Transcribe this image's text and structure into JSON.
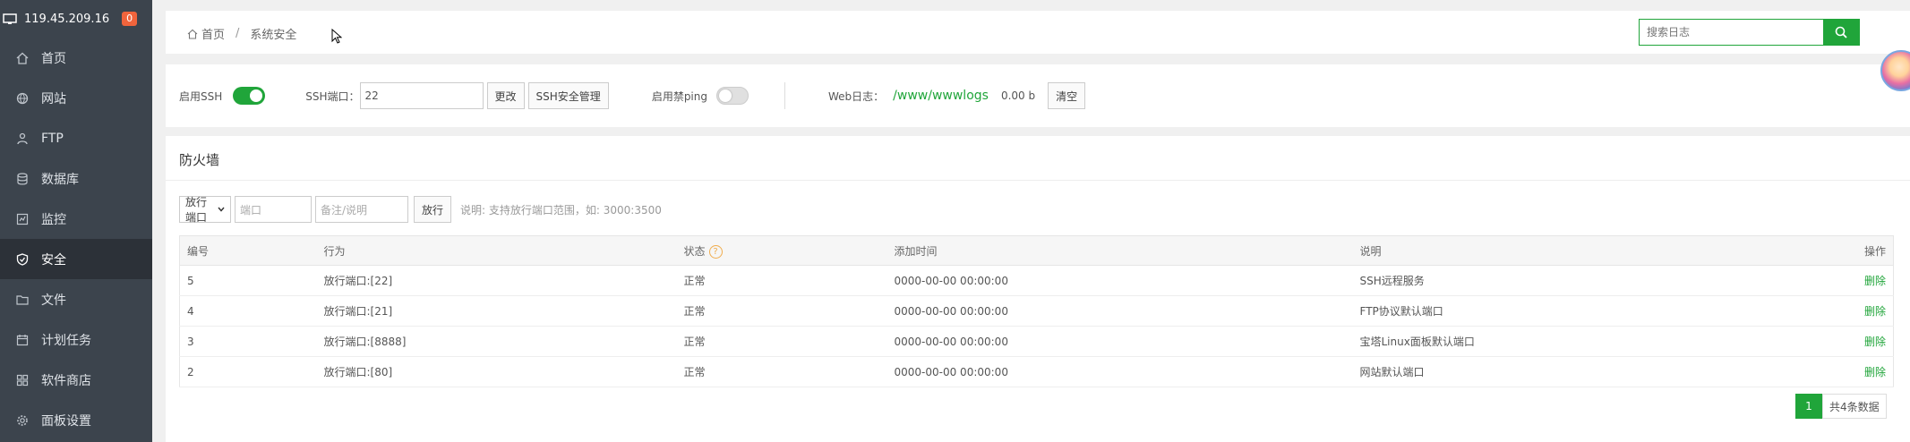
{
  "sidebar": {
    "server_ip": "119.45.209.16",
    "badge": "0",
    "items": [
      {
        "label": "首页",
        "icon": "home-icon"
      },
      {
        "label": "网站",
        "icon": "globe-icon"
      },
      {
        "label": "FTP",
        "icon": "ftp-icon"
      },
      {
        "label": "数据库",
        "icon": "database-icon"
      },
      {
        "label": "监控",
        "icon": "monitor-icon"
      },
      {
        "label": "安全",
        "icon": "shield-icon",
        "active": true
      },
      {
        "label": "文件",
        "icon": "folder-icon"
      },
      {
        "label": "计划任务",
        "icon": "calendar-icon"
      },
      {
        "label": "软件商店",
        "icon": "apps-icon"
      },
      {
        "label": "面板设置",
        "icon": "gear-icon"
      }
    ]
  },
  "header": {
    "breadcrumb_home": "首页",
    "breadcrumb_sep": "/",
    "breadcrumb_current": "系统安全",
    "search_placeholder": "搜索日志"
  },
  "ssh": {
    "enable_ssh_label": "启用SSH",
    "enable_ssh_on": true,
    "port_label": "SSH端口：",
    "port_value": "22",
    "change_button": "更改",
    "manage_button": "SSH安全管理",
    "ping_label": "启用禁ping",
    "ping_on": false,
    "web_log_label": "Web日志：",
    "web_log_path": "/www/wwwlogs",
    "web_log_size": "0.00 b",
    "clear_button": "清空"
  },
  "firewall": {
    "title": "防火墙",
    "select_value": "放行端口",
    "port_placeholder": "端口",
    "remark_placeholder": "备注/说明",
    "allow_button": "放行",
    "note": "说明: 支持放行端口范围，如: 3000:3500",
    "columns": [
      "编号",
      "行为",
      "状态",
      "添加时间",
      "说明",
      "操作"
    ],
    "rows": [
      {
        "id": "5",
        "action": "放行端口:[22]",
        "status": "正常",
        "time": "0000-00-00 00:00:00",
        "desc": "SSH远程服务",
        "op": "删除"
      },
      {
        "id": "4",
        "action": "放行端口:[21]",
        "status": "正常",
        "time": "0000-00-00 00:00:00",
        "desc": "FTP协议默认端口",
        "op": "删除"
      },
      {
        "id": "3",
        "action": "放行端口:[8888]",
        "status": "正常",
        "time": "0000-00-00 00:00:00",
        "desc": "宝塔Linux面板默认端口",
        "op": "删除"
      },
      {
        "id": "2",
        "action": "放行端口:[80]",
        "status": "正常",
        "time": "0000-00-00 00:00:00",
        "desc": "网站默认端口",
        "op": "删除"
      }
    ],
    "page": "1",
    "total": "共4条数据"
  },
  "colors": {
    "accent": "#20a53a",
    "sidebar": "#3c444d",
    "badge": "#f0643c"
  }
}
